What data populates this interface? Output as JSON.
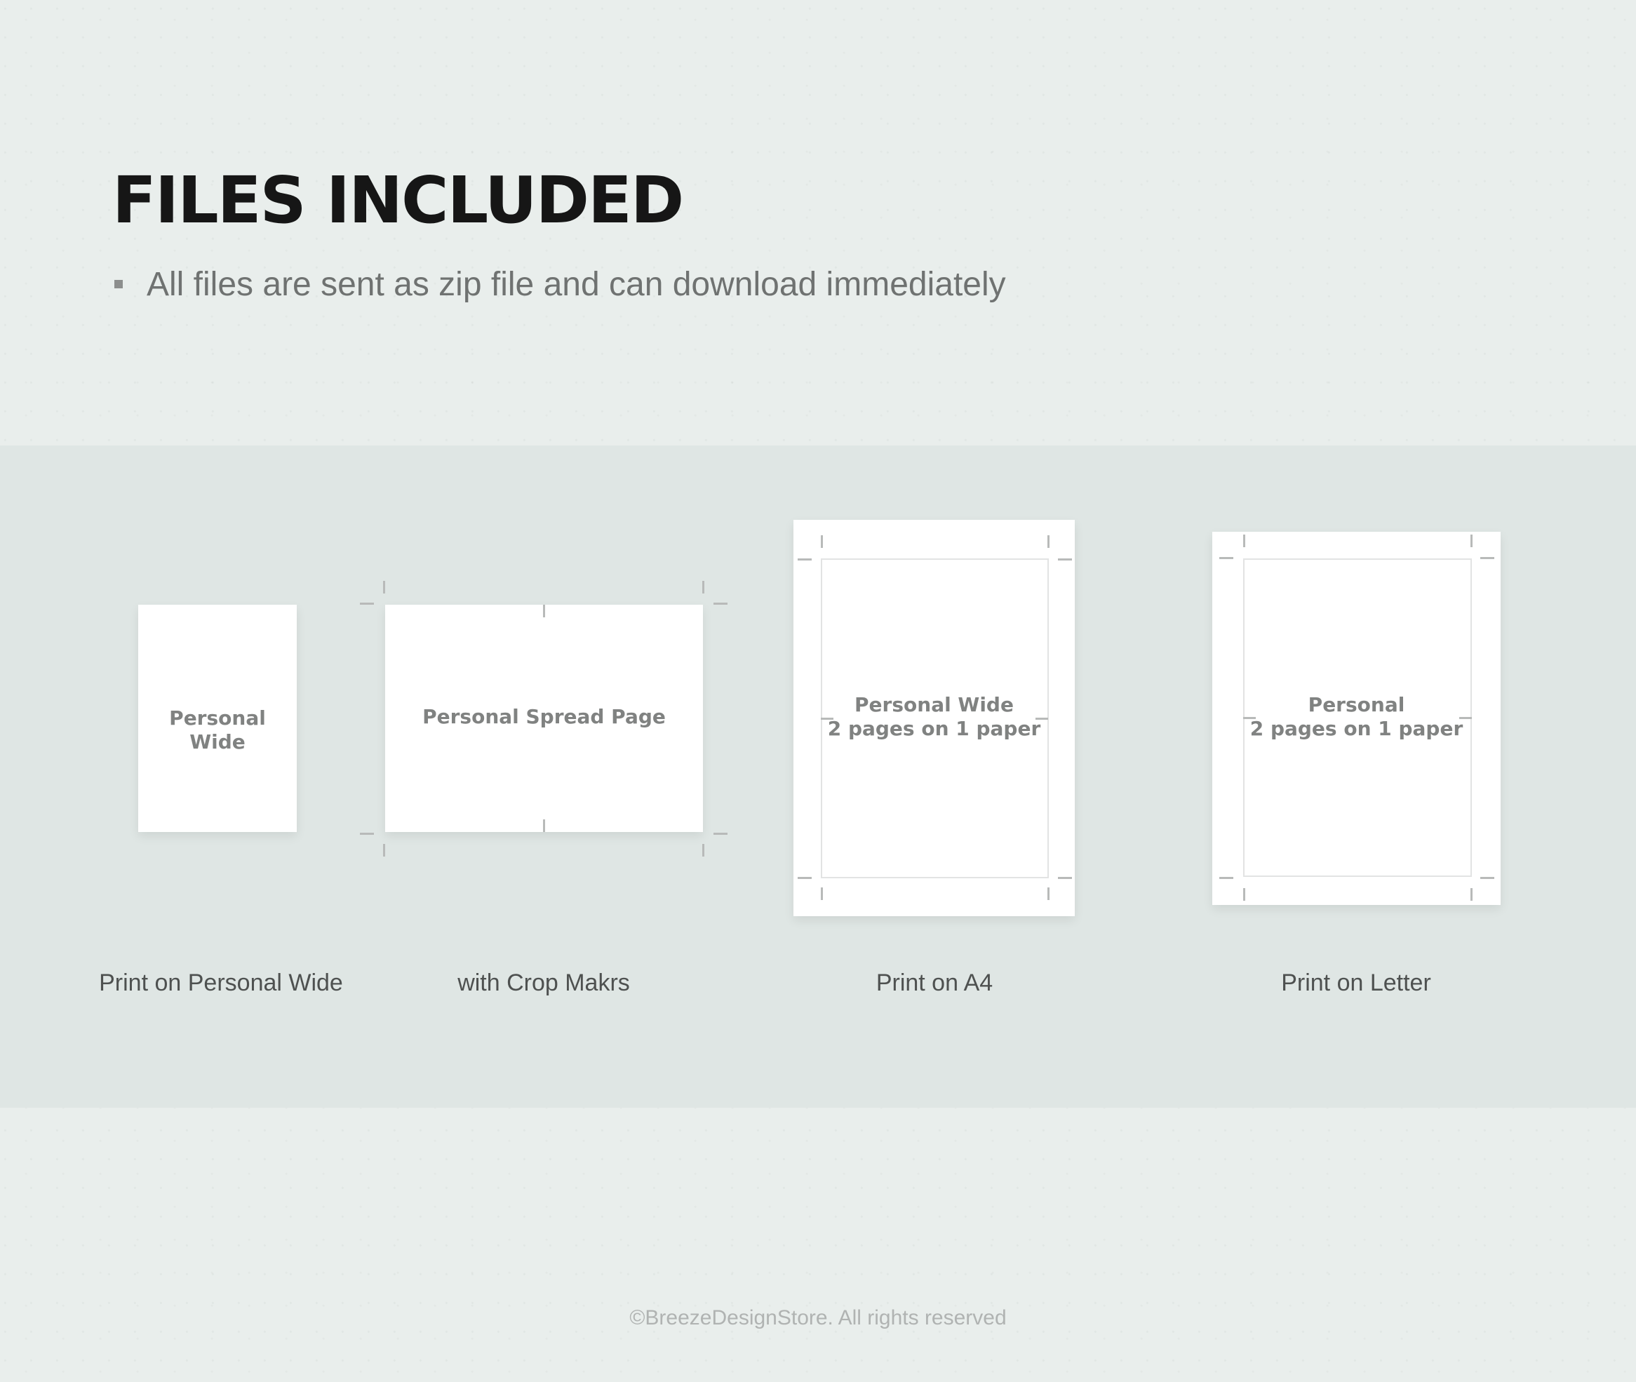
{
  "header": {
    "title": "FILES INCLUDED",
    "bullet": "All files are sent as zip file and can download immediately"
  },
  "cards": [
    {
      "label": "Personal Wide",
      "caption": "Print on Personal Wide"
    },
    {
      "label": "Personal Spread Page",
      "caption": "with Crop Makrs"
    },
    {
      "label_line1": "Personal Wide",
      "label_line2": "2 pages on 1 paper",
      "caption": "Print on A4"
    },
    {
      "label_line1": "Personal",
      "label_line2": "2 pages on 1 paper",
      "caption": "Print on Letter"
    }
  ],
  "footer": {
    "copyright": "©BreezeDesignStore. All rights reserved"
  },
  "colors": {
    "background": "#e9eeec",
    "band": "#dfe6e4",
    "sheet": "#ffffff",
    "title": "#161616"
  }
}
